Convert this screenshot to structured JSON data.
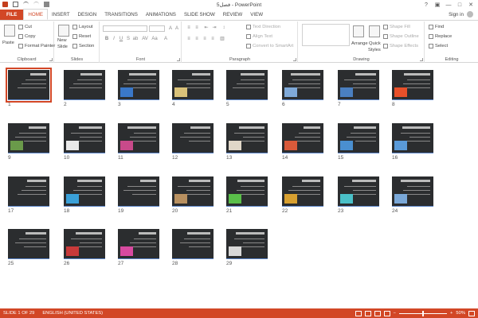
{
  "window": {
    "title": "فصل5 - PowerPoint",
    "controls": [
      "?",
      "▣",
      "—",
      "□",
      "✕"
    ]
  },
  "tabs": [
    "FILE",
    "HOME",
    "INSERT",
    "DESIGN",
    "TRANSITIONS",
    "ANIMATIONS",
    "SLIDE SHOW",
    "REVIEW",
    "VIEW"
  ],
  "active_tab": "HOME",
  "signin": "Sign in",
  "ribbon": {
    "clipboard": {
      "paste": "Paste",
      "cut": "Cut",
      "copy": "Copy",
      "format_painter": "Format Painter",
      "label": "Clipboard"
    },
    "slides": {
      "new_slide_line1": "New",
      "new_slide_line2": "Slide",
      "layout": "Layout",
      "reset": "Reset",
      "section": "Section",
      "label": "Slides"
    },
    "font": {
      "label": "Font"
    },
    "paragraph": {
      "text_direction": "Text Direction",
      "align_text": "Align Text",
      "convert_smartart": "Convert to SmartArt",
      "label": "Paragraph"
    },
    "drawing": {
      "arrange": "Arrange",
      "quick_styles_line1": "Quick",
      "quick_styles_line2": "Styles",
      "shape_fill": "Shape Fill",
      "shape_outline": "Shape Outline",
      "shape_effects": "Shape Effects",
      "label": "Drawing"
    },
    "editing": {
      "find": "Find",
      "replace": "Replace",
      "select": "Select",
      "label": "Editing"
    }
  },
  "slides": [
    {
      "n": "1",
      "pic": ""
    },
    {
      "n": "2",
      "pic": ""
    },
    {
      "n": "3",
      "pic": "#3a78c9"
    },
    {
      "n": "4",
      "pic": "#d9c27a"
    },
    {
      "n": "5",
      "pic": ""
    },
    {
      "n": "6",
      "pic": "#7fa9d8"
    },
    {
      "n": "7",
      "pic": "#4a7fc0"
    },
    {
      "n": "8",
      "pic": "#e8502a"
    },
    {
      "n": "9",
      "pic": "#6a9a4a"
    },
    {
      "n": "10",
      "pic": "#e9e9e9"
    },
    {
      "n": "11",
      "pic": "#c84a8a"
    },
    {
      "n": "12",
      "pic": ""
    },
    {
      "n": "13",
      "pic": "#e0d7c8"
    },
    {
      "n": "14",
      "pic": "#d95a3a"
    },
    {
      "n": "15",
      "pic": "#4a8fd0"
    },
    {
      "n": "16",
      "pic": "#5a9ad8"
    },
    {
      "n": "17",
      "pic": ""
    },
    {
      "n": "18",
      "pic": "#3aa0d8"
    },
    {
      "n": "19",
      "pic": ""
    },
    {
      "n": "20",
      "pic": "#b89060"
    },
    {
      "n": "21",
      "pic": "#5abf4a"
    },
    {
      "n": "22",
      "pic": "#d8a030"
    },
    {
      "n": "23",
      "pic": "#4ac0c8"
    },
    {
      "n": "24",
      "pic": "#7aa8d8"
    },
    {
      "n": "25",
      "pic": ""
    },
    {
      "n": "26",
      "pic": "#c83a3a"
    },
    {
      "n": "27",
      "pic": "#d84aa0"
    },
    {
      "n": "28",
      "pic": ""
    },
    {
      "n": "29",
      "pic": "#d8d8d8"
    }
  ],
  "selected_slide": "1",
  "status": {
    "slide_info": "SLIDE 1 OF 29",
    "language": "ENGLISH (UNITED STATES)",
    "zoom": "50%"
  },
  "colors": {
    "accent": "#d24726",
    "slide_bg": "#2b2d2f"
  }
}
